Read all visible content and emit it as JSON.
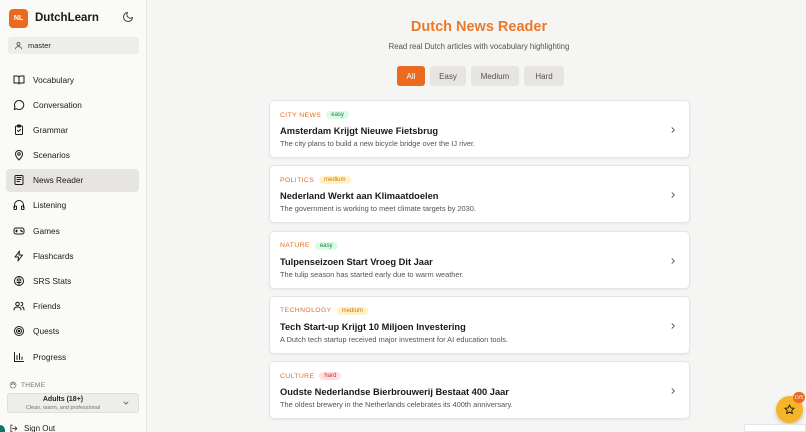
{
  "app": {
    "logo_text": "NL",
    "name": "DutchLearn"
  },
  "user": {
    "name": "master"
  },
  "sidebar": {
    "items": [
      {
        "label": "Vocabulary",
        "icon": "book-icon"
      },
      {
        "label": "Conversation",
        "icon": "chat-bubble-icon"
      },
      {
        "label": "Grammar",
        "icon": "clipboard-check-icon"
      },
      {
        "label": "Scenarios",
        "icon": "map-pin-icon"
      },
      {
        "label": "News Reader",
        "icon": "newspaper-icon",
        "active": true
      },
      {
        "label": "Listening",
        "icon": "headphones-icon"
      },
      {
        "label": "Games",
        "icon": "gamepad-icon"
      },
      {
        "label": "Flashcards",
        "icon": "lightning-icon"
      },
      {
        "label": "SRS Stats",
        "icon": "brain-icon"
      },
      {
        "label": "Friends",
        "icon": "users-icon"
      },
      {
        "label": "Quests",
        "icon": "target-icon"
      },
      {
        "label": "Progress",
        "icon": "bar-chart-icon"
      }
    ],
    "theme": {
      "title": "THEME",
      "value": "Adults (18+)",
      "description": "Clean, warm, and professional"
    },
    "sign_out": "Sign Out"
  },
  "main": {
    "title": "Dutch News Reader",
    "subtitle": "Read real Dutch articles with vocabulary highlighting",
    "filters": [
      "All",
      "Easy",
      "Medium",
      "Hard"
    ],
    "active_filter": "All",
    "articles": [
      {
        "category": "CITY NEWS",
        "level": "easy",
        "title": "Amsterdam Krijgt Nieuwe Fietsbrug",
        "description": "The city plans to build a new bicycle bridge over the IJ river."
      },
      {
        "category": "POLITICS",
        "level": "medium",
        "title": "Nederland Werkt aan Klimaatdoelen",
        "description": "The government is working to meet climate targets by 2030."
      },
      {
        "category": "NATURE",
        "level": "easy",
        "title": "Tulpenseizoen Start Vroeg Dit Jaar",
        "description": "The tulip season has started early due to warm weather."
      },
      {
        "category": "TECHNOLOGY",
        "level": "medium",
        "title": "Tech Start-up Krijgt 10 Miljoen Investering",
        "description": "A Dutch tech startup received major investment for AI education tools."
      },
      {
        "category": "CULTURE",
        "level": "hard",
        "title": "Oudste Nederlandse Bierbrouwerij Bestaat 400 Jaar",
        "description": "The oldest brewery in the Netherlands celebrates its 400th anniversary."
      }
    ]
  },
  "fab": {
    "icon": "star-icon",
    "badge": "LV5"
  },
  "colors": {
    "accent": "#ea6a1f",
    "title": "#ea7a2a",
    "easy": "#15803d",
    "medium": "#d97706",
    "hard": "#dc2626"
  }
}
